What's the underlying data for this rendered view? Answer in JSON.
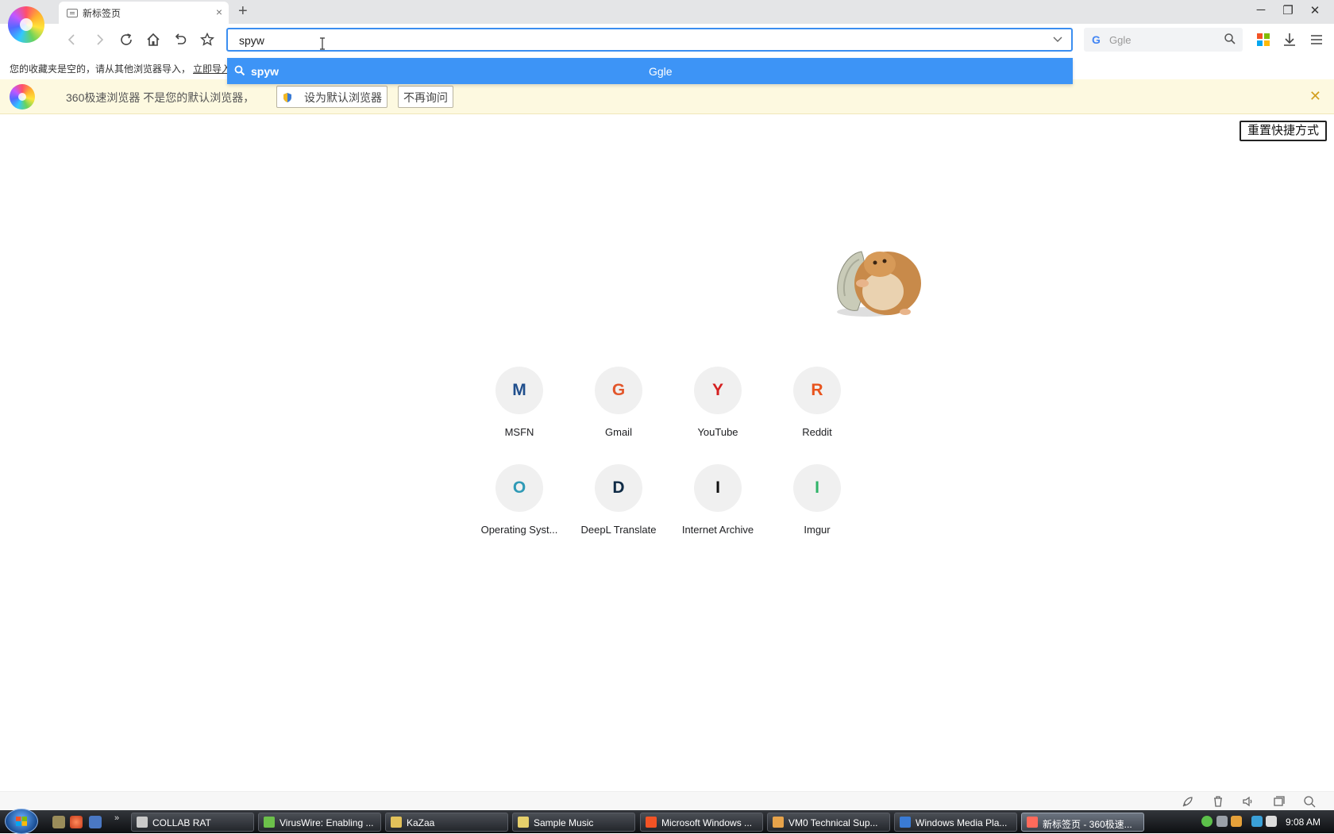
{
  "tab": {
    "title": "新标签页",
    "close_glyph": "×",
    "new_tab_glyph": "+"
  },
  "window_controls": {
    "minimize": "─",
    "restore": "❐",
    "close": "✕"
  },
  "toolbar": {
    "url_value": "spyw",
    "search_engine_placeholder": "Ggle",
    "search_engine_letter": "G"
  },
  "bookmarks_bar": {
    "hint": "您的收藏夹是空的，请从其他浏览器导入，",
    "import_link": "立即导入"
  },
  "suggestion": {
    "term": "spyw",
    "engine": "Ggle"
  },
  "notice": {
    "text": "360极速浏览器 不是您的默认浏览器，",
    "set_default_label": "设为默认浏览器",
    "dont_ask_label": "不再询问",
    "close_glyph": "✕"
  },
  "reset_shortcuts_label": "重置快捷方式",
  "speed_dials": [
    {
      "letter": "M",
      "label": "MSFN",
      "color": "#1f4e8c"
    },
    {
      "letter": "G",
      "label": "Gmail",
      "color": "#e2562b"
    },
    {
      "letter": "Y",
      "label": "YouTube",
      "color": "#d42020"
    },
    {
      "letter": "R",
      "label": "Reddit",
      "color": "#e8541d"
    },
    {
      "letter": "O",
      "label": "Operating Syst...",
      "color": "#2f9ab6"
    },
    {
      "letter": "D",
      "label": "DeepL Translate",
      "color": "#0f2b46"
    },
    {
      "letter": "I",
      "label": "Internet Archive",
      "color": "#111111"
    },
    {
      "letter": "I",
      "label": "Imgur",
      "color": "#2fb368"
    }
  ],
  "taskbar": {
    "tasks": [
      {
        "label": "COLLAB RAT",
        "icon_color": "#c9c9c9"
      },
      {
        "label": "VirusWire: Enabling ...",
        "icon_color": "#6cc04a"
      },
      {
        "label": "KaZaa",
        "icon_color": "#e2c15a"
      },
      {
        "label": "Sample Music",
        "icon_color": "#e6cf6b"
      },
      {
        "label": "Microsoft Windows ...",
        "icon_color": "#f35325"
      },
      {
        "label": "VM0 Technical Sup...",
        "icon_color": "#e7a34a"
      },
      {
        "label": "Windows Media Pla...",
        "icon_color": "#3a7bd5"
      },
      {
        "label": "新标签页 - 360极速...",
        "icon_color": "#ff6a5b"
      }
    ],
    "quick_launch_more": "»",
    "clock": "9:08 AM"
  },
  "icons": {
    "back": "arrow-left-icon",
    "forward": "arrow-right-icon",
    "reload": "reload-icon",
    "home": "home-icon",
    "undo": "undo-icon",
    "star": "star-icon"
  }
}
